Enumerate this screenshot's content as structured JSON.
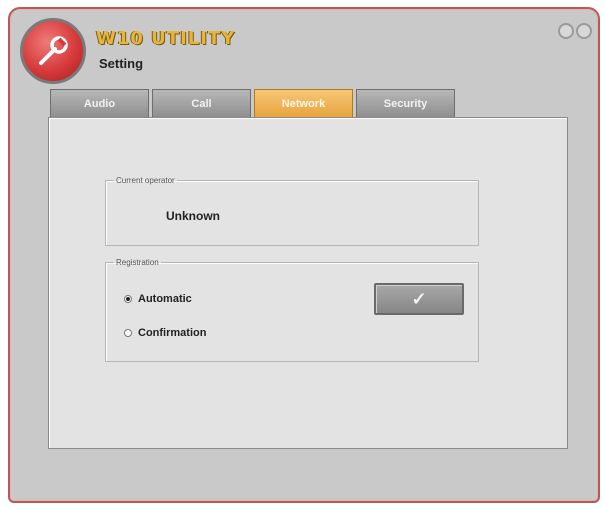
{
  "app": {
    "title": "W10 UTILITY",
    "subtitle": "Setting",
    "logo_icon": "wrench-icon",
    "brand_color": "#d63a3a",
    "title_color": "#e8b53a"
  },
  "tabs": [
    {
      "label": "Audio",
      "active": false
    },
    {
      "label": "Call",
      "active": false
    },
    {
      "label": "Network",
      "active": true
    },
    {
      "label": "Security",
      "active": false
    }
  ],
  "current_operator": {
    "legend": "Current operator",
    "value": "Unknown"
  },
  "registration": {
    "legend": "Registration",
    "options": [
      {
        "label": "Automatic",
        "selected": true
      },
      {
        "label": "Confirmation",
        "selected": false
      }
    ],
    "confirm_icon": "checkmark-icon",
    "confirm_glyph": "✓"
  },
  "colors": {
    "active_tab": "#e8a33d",
    "frame_border": "#b45a5a"
  }
}
